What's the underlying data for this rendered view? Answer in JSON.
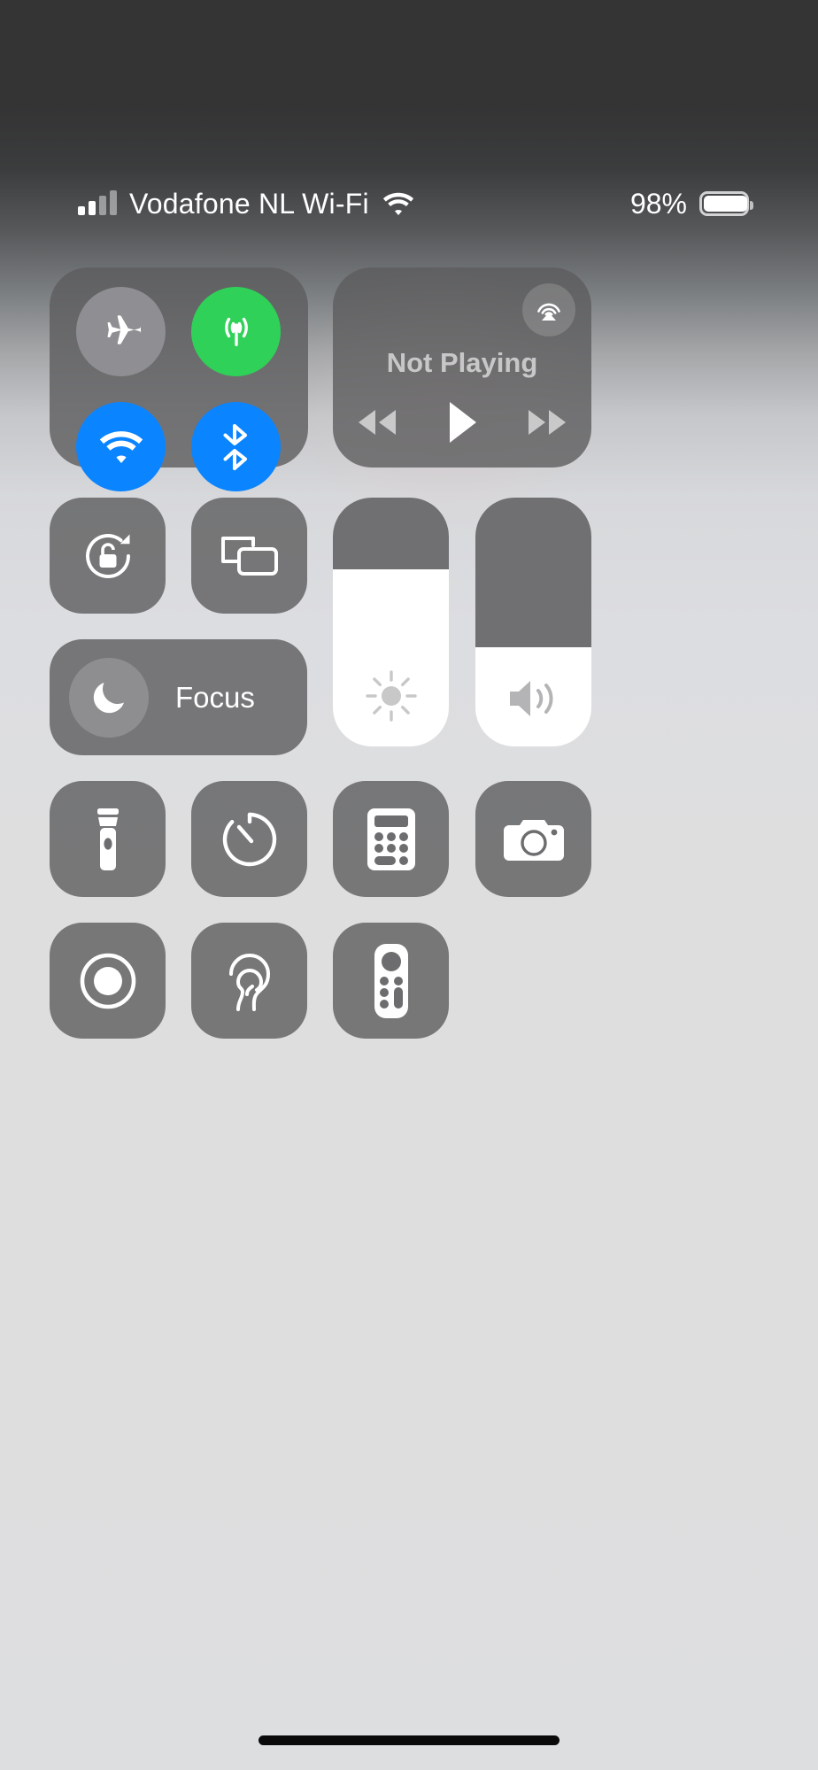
{
  "status_bar": {
    "carrier": "Vodafone NL Wi-Fi",
    "signal_bars_filled": 2,
    "signal_bars_total": 4,
    "wifi_icon": "wifi-icon",
    "battery_percent": "98%",
    "battery_level": 98
  },
  "colors": {
    "tile_bg": "#5c5c5e",
    "toggle_on_blue": "#0a84ff",
    "toggle_on_green": "#30d158",
    "toggle_off_gray": "#8e8e93",
    "slider_fill": "#ffffff",
    "text_white": "#ffffff",
    "media_text": "#9d9d9f"
  },
  "connectivity": {
    "toggles": [
      {
        "name": "airplane-mode",
        "icon": "airplane-icon",
        "state": "off",
        "color": "#8e8e93"
      },
      {
        "name": "cellular-data",
        "icon": "cellular-antenna-icon",
        "state": "on",
        "color": "#30d158"
      },
      {
        "name": "wifi",
        "icon": "wifi-icon",
        "state": "on",
        "color": "#0a84ff"
      },
      {
        "name": "bluetooth",
        "icon": "bluetooth-icon",
        "state": "on",
        "color": "#0a84ff"
      }
    ]
  },
  "media": {
    "title": "Not Playing",
    "airplay_icon": "airplay-audio-icon",
    "controls": [
      {
        "name": "rewind",
        "icon": "rewind-icon"
      },
      {
        "name": "play",
        "icon": "play-icon"
      },
      {
        "name": "forward",
        "icon": "fast-forward-icon"
      }
    ]
  },
  "utility_buttons": {
    "rotation_lock": {
      "icon": "rotation-lock-icon",
      "state": "off"
    },
    "screen_mirroring": {
      "icon": "screen-mirroring-icon",
      "state": "off"
    }
  },
  "focus": {
    "label": "Focus",
    "icon": "moon-icon",
    "state": "off"
  },
  "sliders": {
    "brightness": {
      "icon": "brightness-sun-icon",
      "value": 71,
      "unfilled_percent": 29
    },
    "volume": {
      "icon": "speaker-volume-icon",
      "value": 40,
      "unfilled_percent": 60
    }
  },
  "shortcuts": [
    {
      "name": "flashlight",
      "icon": "flashlight-icon"
    },
    {
      "name": "timer",
      "icon": "timer-icon"
    },
    {
      "name": "calculator",
      "icon": "calculator-icon"
    },
    {
      "name": "camera",
      "icon": "camera-icon"
    },
    {
      "name": "screen-recording",
      "icon": "screen-record-icon"
    },
    {
      "name": "hearing",
      "icon": "ear-hearing-icon"
    },
    {
      "name": "apple-tv-remote",
      "icon": "remote-icon"
    }
  ],
  "home_indicator": {
    "name": "home-indicator"
  }
}
